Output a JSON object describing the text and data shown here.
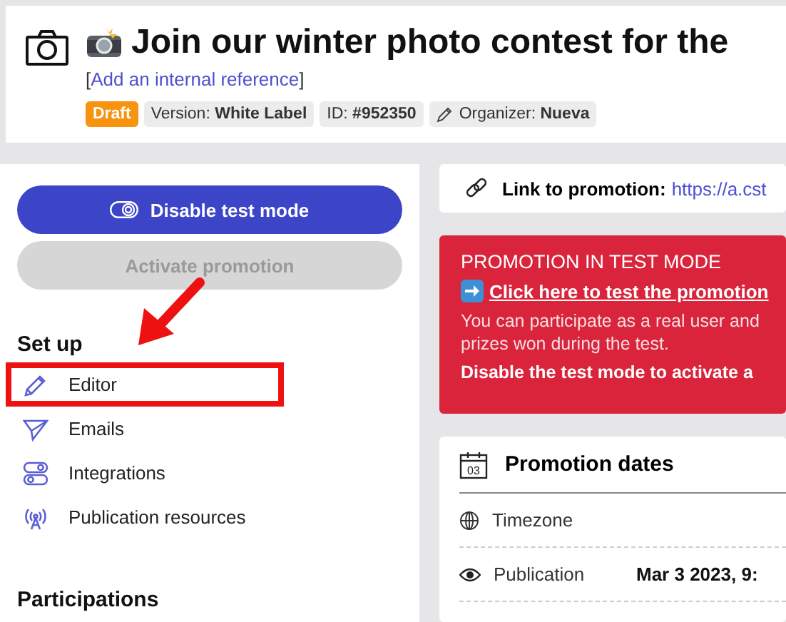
{
  "header": {
    "title": "Join our winter photo contest for the",
    "reference_open": "[",
    "reference_link": "Add an internal reference",
    "reference_close": "]",
    "tags": [
      {
        "kind": "status",
        "label": "Draft"
      },
      {
        "kind": "info",
        "label": "Version:",
        "value": "White Label"
      },
      {
        "kind": "info",
        "label": "ID:",
        "value": "#952350"
      },
      {
        "kind": "organizer",
        "label": "Organizer:",
        "value": "Nueva"
      }
    ]
  },
  "sidebar": {
    "primary_button": "Disable test mode",
    "secondary_button": {
      "label": "Activate promotion",
      "disabled": true
    },
    "section_title": "Set up",
    "items": [
      {
        "kind": "editor",
        "label": "Editor",
        "highlighted": true
      },
      {
        "kind": "emails",
        "label": "Emails",
        "highlighted": false
      },
      {
        "kind": "integrations",
        "label": "Integrations",
        "highlighted": false
      },
      {
        "kind": "publication",
        "label": "Publication resources",
        "highlighted": false
      }
    ],
    "next_section_title": "Participations"
  },
  "link_card": {
    "label": "Link to promotion:",
    "url": "https://a.cst"
  },
  "alert": {
    "title": "PROMOTION IN TEST MODE",
    "link": "Click here to test the promotion",
    "text_1": "You can participate as a real user and",
    "text_2": "prizes won during the test.",
    "text_3": "Disable the test mode to activate a"
  },
  "dates": {
    "title": "Promotion dates",
    "icon_day": "03",
    "rows": [
      {
        "kind": "timezone",
        "label": "Timezone"
      },
      {
        "kind": "publication",
        "label": "Publication",
        "value": "Mar 3 2023, 9:"
      }
    ]
  }
}
